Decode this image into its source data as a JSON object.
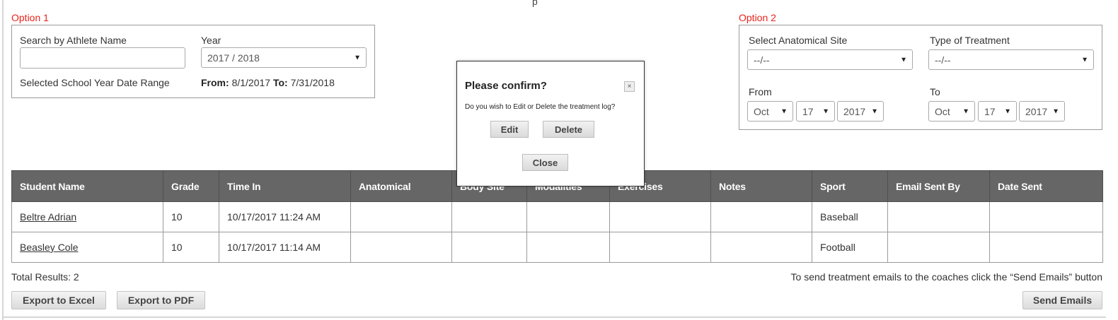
{
  "top_cut_text": "p",
  "option1": {
    "label": "Option 1",
    "search_label": "Search by Athlete Name",
    "search_value": "",
    "year_label": "Year",
    "year_value": "2017 / 2018",
    "date_range_label": "Selected School Year Date Range",
    "from_label": "From:",
    "from_value": "8/1/2017",
    "to_label": "To:",
    "to_value": "7/31/2018"
  },
  "option2": {
    "label": "Option 2",
    "site_label": "Select Anatomical Site",
    "site_value": "--/--",
    "treatment_label": "Type of Treatment",
    "treatment_value": "--/--",
    "from_label": "From",
    "from_month": "Oct",
    "from_day": "17",
    "from_year": "2017",
    "to_label": "To",
    "to_month": "Oct",
    "to_day": "17",
    "to_year": "2017"
  },
  "dialog": {
    "title": "Please confirm?",
    "close_icon": "×",
    "message": "Do you wish to Edit or Delete the treatment log?",
    "edit_label": "Edit",
    "delete_label": "Delete",
    "close_label": "Close"
  },
  "table": {
    "headers": [
      "Student Name",
      "Grade",
      "Time In",
      "Anatomical",
      "Body Site",
      "Modalities",
      "Exercises",
      "Notes",
      "Sport",
      "Email Sent By",
      "Date Sent"
    ],
    "rows": [
      [
        "Beltre Adrian",
        "10",
        "10/17/2017 11:24 AM",
        "",
        "",
        "",
        "",
        "",
        "Baseball",
        "",
        ""
      ],
      [
        "Beasley Cole",
        "10",
        "10/17/2017 11:14 AM",
        "",
        "",
        "",
        "",
        "",
        "Football",
        "",
        ""
      ]
    ]
  },
  "footer": {
    "total_results": "Total Results: 2",
    "email_hint": "To send treatment emails to the coaches click the “Send Emails” button",
    "export_excel": "Export to Excel",
    "export_pdf": "Export to PDF",
    "send_emails": "Send Emails"
  },
  "icons": {
    "dropdown": "chevron-down-icon",
    "close": "close-icon"
  }
}
